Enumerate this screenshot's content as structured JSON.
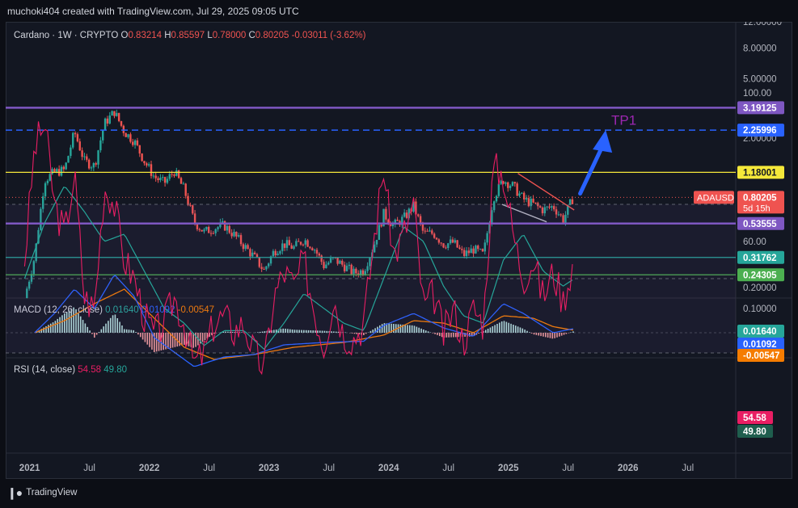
{
  "header": {
    "text": "muchoki404 created with TradingView.com, Jul 29, 2025 09:05 UTC"
  },
  "footer": {
    "logo_text": "TradingView"
  },
  "price_legend": {
    "symbol": "Cardano · 1W · CRYPTO",
    "open_label": "O",
    "open": "0.83214",
    "high_label": "H",
    "high": "0.85597",
    "low_label": "L",
    "low": "0.78000",
    "close_label": "C",
    "close": "0.80205",
    "change": "-0.03011 (-3.62%)"
  },
  "macd_legend": {
    "label": "MACD (12, 26, close)",
    "v1": "0.01640",
    "v2": "0.01092",
    "v3": "-0.00547"
  },
  "rsi_legend": {
    "label": "RSI (14, close)",
    "v1": "54.58",
    "v2": "49.80"
  },
  "annotation": {
    "tp_label": "TP1"
  },
  "colors": {
    "up": "#26a69a",
    "down": "#ef5350",
    "purple": "#7e57c2",
    "yellow": "#f5e83a",
    "blue": "#2962ff",
    "orange": "#f57c00",
    "rsi": "#e91e63",
    "rsi_ma": "#26a69a",
    "green_line": "#4caf50"
  },
  "chart_data": {
    "type": "candlestick",
    "symbol": "ADAUSD",
    "interval": "1W",
    "scale": "log",
    "ylim": [
      0.17,
      12
    ],
    "y_ticks": [
      "12.00000",
      "8.00000",
      "5.00000",
      "2.00000",
      "0.20000"
    ],
    "x_ticks": [
      "2021",
      "Jul",
      "2022",
      "Jul",
      "2023",
      "Jul",
      "2024",
      "Jul",
      "2025",
      "Jul",
      "2026",
      "Jul"
    ],
    "current_price": {
      "label": "ADAUSD",
      "value": "0.80205",
      "countdown": "5d 15h"
    },
    "levels": [
      {
        "value": 3.19125,
        "label": "3.19125",
        "style": "solid",
        "color": "#7e57c2"
      },
      {
        "value": 2.25996,
        "label": "2.25996",
        "style": "dashed",
        "color": "#2962ff"
      },
      {
        "value": 1.18001,
        "label": "1.18001",
        "style": "solid",
        "color": "#f5e83a"
      },
      {
        "value": 0.53555,
        "label": "0.53555",
        "style": "solid",
        "color": "#7e57c2"
      },
      {
        "value": 0.31762,
        "label": "0.31762",
        "style": "solid",
        "color": "#26a69a"
      },
      {
        "value": 0.24305,
        "label": "0.24305",
        "style": "solid",
        "color": "#4caf50"
      }
    ],
    "close_path": [
      [
        "2020-12",
        0.17
      ],
      [
        "2021-01",
        0.32
      ],
      [
        "2021-02",
        1.05
      ],
      [
        "2021-03",
        1.18
      ],
      [
        "2021-04",
        1.22
      ],
      [
        "2021-05",
        2.2
      ],
      [
        "2021-06",
        1.4
      ],
      [
        "2021-07",
        1.3
      ],
      [
        "2021-08",
        2.5
      ],
      [
        "2021-09",
        3.0
      ],
      [
        "2021-10",
        2.2
      ],
      [
        "2021-11",
        1.9
      ],
      [
        "2021-12",
        1.4
      ],
      [
        "2022-01",
        1.1
      ],
      [
        "2022-02",
        1.0
      ],
      [
        "2022-03",
        1.2
      ],
      [
        "2022-04",
        0.9
      ],
      [
        "2022-05",
        0.55
      ],
      [
        "2022-06",
        0.47
      ],
      [
        "2022-07",
        0.5
      ],
      [
        "2022-08",
        0.52
      ],
      [
        "2022-09",
        0.45
      ],
      [
        "2022-10",
        0.38
      ],
      [
        "2022-11",
        0.32
      ],
      [
        "2022-12",
        0.26
      ],
      [
        "2023-01",
        0.35
      ],
      [
        "2023-02",
        0.39
      ],
      [
        "2023-03",
        0.37
      ],
      [
        "2023-04",
        0.42
      ],
      [
        "2023-05",
        0.37
      ],
      [
        "2023-06",
        0.28
      ],
      [
        "2023-07",
        0.31
      ],
      [
        "2023-08",
        0.28
      ],
      [
        "2023-09",
        0.25
      ],
      [
        "2023-10",
        0.26
      ],
      [
        "2023-11",
        0.38
      ],
      [
        "2023-12",
        0.62
      ],
      [
        "2024-01",
        0.52
      ],
      [
        "2024-02",
        0.58
      ],
      [
        "2024-03",
        0.7
      ],
      [
        "2024-04",
        0.46
      ],
      [
        "2024-05",
        0.46
      ],
      [
        "2024-06",
        0.39
      ],
      [
        "2024-07",
        0.4
      ],
      [
        "2024-08",
        0.33
      ],
      [
        "2024-09",
        0.36
      ],
      [
        "2024-10",
        0.33
      ],
      [
        "2024-11",
        0.8
      ],
      [
        "2024-12",
        1.05
      ],
      [
        "2025-01",
        0.95
      ],
      [
        "2025-02",
        0.78
      ],
      [
        "2025-03",
        0.72
      ],
      [
        "2025-04",
        0.66
      ],
      [
        "2025-05",
        0.7
      ],
      [
        "2025-06",
        0.57
      ],
      [
        "2025-07",
        0.8
      ]
    ],
    "macd_axis": {
      "ticks": [
        "0.10000"
      ]
    },
    "macd_current": {
      "macd": "0.01640",
      "signal": "0.01092",
      "hist": "-0.00547"
    },
    "macd_line": [
      [
        "2021-01",
        0.0
      ],
      [
        "2021-03",
        0.08
      ],
      [
        "2021-05",
        0.18
      ],
      [
        "2021-07",
        0.1
      ],
      [
        "2021-09",
        0.24
      ],
      [
        "2021-11",
        0.15
      ],
      [
        "2022-01",
        -0.02
      ],
      [
        "2022-03",
        -0.08
      ],
      [
        "2022-05",
        -0.14
      ],
      [
        "2022-08",
        -0.1
      ],
      [
        "2022-11",
        -0.09
      ],
      [
        "2023-02",
        -0.05
      ],
      [
        "2023-06",
        -0.04
      ],
      [
        "2023-10",
        -0.035
      ],
      [
        "2023-12",
        0.03
      ],
      [
        "2024-03",
        0.08
      ],
      [
        "2024-06",
        0.02
      ],
      [
        "2024-09",
        -0.015
      ],
      [
        "2024-12",
        0.12
      ],
      [
        "2025-02",
        0.08
      ],
      [
        "2025-05",
        0.0
      ],
      [
        "2025-07",
        0.0164
      ]
    ],
    "signal_line": [
      [
        "2021-01",
        0.0
      ],
      [
        "2021-04",
        0.05
      ],
      [
        "2021-07",
        0.12
      ],
      [
        "2021-10",
        0.18
      ],
      [
        "2022-01",
        0.06
      ],
      [
        "2022-04",
        -0.06
      ],
      [
        "2022-07",
        -0.11
      ],
      [
        "2022-11",
        -0.09
      ],
      [
        "2023-03",
        -0.06
      ],
      [
        "2023-08",
        -0.04
      ],
      [
        "2023-12",
        -0.01
      ],
      [
        "2024-03",
        0.05
      ],
      [
        "2024-06",
        0.04
      ],
      [
        "2024-09",
        0.0
      ],
      [
        "2024-12",
        0.07
      ],
      [
        "2025-03",
        0.06
      ],
      [
        "2025-05",
        0.025
      ],
      [
        "2025-07",
        0.0109
      ]
    ],
    "rsi_axis": {
      "ticks": [
        "100.00",
        "60.00"
      ]
    },
    "rsi_levels": [
      70,
      50,
      30
    ],
    "rsi_current": {
      "rsi": "54.58",
      "ma": "49.80"
    },
    "rsi_line": [
      [
        "2020-12",
        55
      ],
      [
        "2021-01",
        85
      ],
      [
        "2021-02",
        92
      ],
      [
        "2021-03",
        70
      ],
      [
        "2021-04",
        62
      ],
      [
        "2021-05",
        78
      ],
      [
        "2021-06",
        45
      ],
      [
        "2021-07",
        42
      ],
      [
        "2021-08",
        75
      ],
      [
        "2021-09",
        70
      ],
      [
        "2021-10",
        55
      ],
      [
        "2021-11",
        50
      ],
      [
        "2021-12",
        40
      ],
      [
        "2022-01",
        35
      ],
      [
        "2022-02",
        38
      ],
      [
        "2022-03",
        45
      ],
      [
        "2022-04",
        38
      ],
      [
        "2022-05",
        27
      ],
      [
        "2022-06",
        30
      ],
      [
        "2022-07",
        38
      ],
      [
        "2022-08",
        40
      ],
      [
        "2022-09",
        36
      ],
      [
        "2022-10",
        38
      ],
      [
        "2022-11",
        30
      ],
      [
        "2022-12",
        26
      ],
      [
        "2023-01",
        45
      ],
      [
        "2023-02",
        52
      ],
      [
        "2023-03",
        48
      ],
      [
        "2023-04",
        55
      ],
      [
        "2023-05",
        42
      ],
      [
        "2023-06",
        32
      ],
      [
        "2023-07",
        45
      ],
      [
        "2023-08",
        35
      ],
      [
        "2023-09",
        34
      ],
      [
        "2023-10",
        38
      ],
      [
        "2023-11",
        60
      ],
      [
        "2023-12",
        80
      ],
      [
        "2024-01",
        56
      ],
      [
        "2024-02",
        62
      ],
      [
        "2024-03",
        70
      ],
      [
        "2024-04",
        42
      ],
      [
        "2024-05",
        46
      ],
      [
        "2024-06",
        35
      ],
      [
        "2024-07",
        42
      ],
      [
        "2024-08",
        33
      ],
      [
        "2024-09",
        42
      ],
      [
        "2024-10",
        38
      ],
      [
        "2024-11",
        80
      ],
      [
        "2024-12",
        78
      ],
      [
        "2025-01",
        62
      ],
      [
        "2025-02",
        50
      ],
      [
        "2025-03",
        55
      ],
      [
        "2025-04",
        45
      ],
      [
        "2025-05",
        52
      ],
      [
        "2025-06",
        44
      ],
      [
        "2025-07",
        54.58
      ]
    ],
    "rsi_ma_line": [
      [
        "2020-12",
        50
      ],
      [
        "2021-02",
        65
      ],
      [
        "2021-04",
        75
      ],
      [
        "2021-06",
        68
      ],
      [
        "2021-08",
        60
      ],
      [
        "2021-10",
        62
      ],
      [
        "2021-12",
        52
      ],
      [
        "2022-02",
        42
      ],
      [
        "2022-04",
        38
      ],
      [
        "2022-06",
        32
      ],
      [
        "2022-08",
        36
      ],
      [
        "2022-10",
        36
      ],
      [
        "2022-12",
        31
      ],
      [
        "2023-02",
        38
      ],
      [
        "2023-04",
        46
      ],
      [
        "2023-06",
        42
      ],
      [
        "2023-08",
        38
      ],
      [
        "2023-10",
        36
      ],
      [
        "2023-12",
        50
      ],
      [
        "2024-02",
        64
      ],
      [
        "2024-04",
        60
      ],
      [
        "2024-06",
        48
      ],
      [
        "2024-08",
        40
      ],
      [
        "2024-10",
        38
      ],
      [
        "2024-12",
        55
      ],
      [
        "2025-02",
        62
      ],
      [
        "2025-04",
        52
      ],
      [
        "2025-06",
        48
      ],
      [
        "2025-07",
        49.8
      ]
    ]
  }
}
